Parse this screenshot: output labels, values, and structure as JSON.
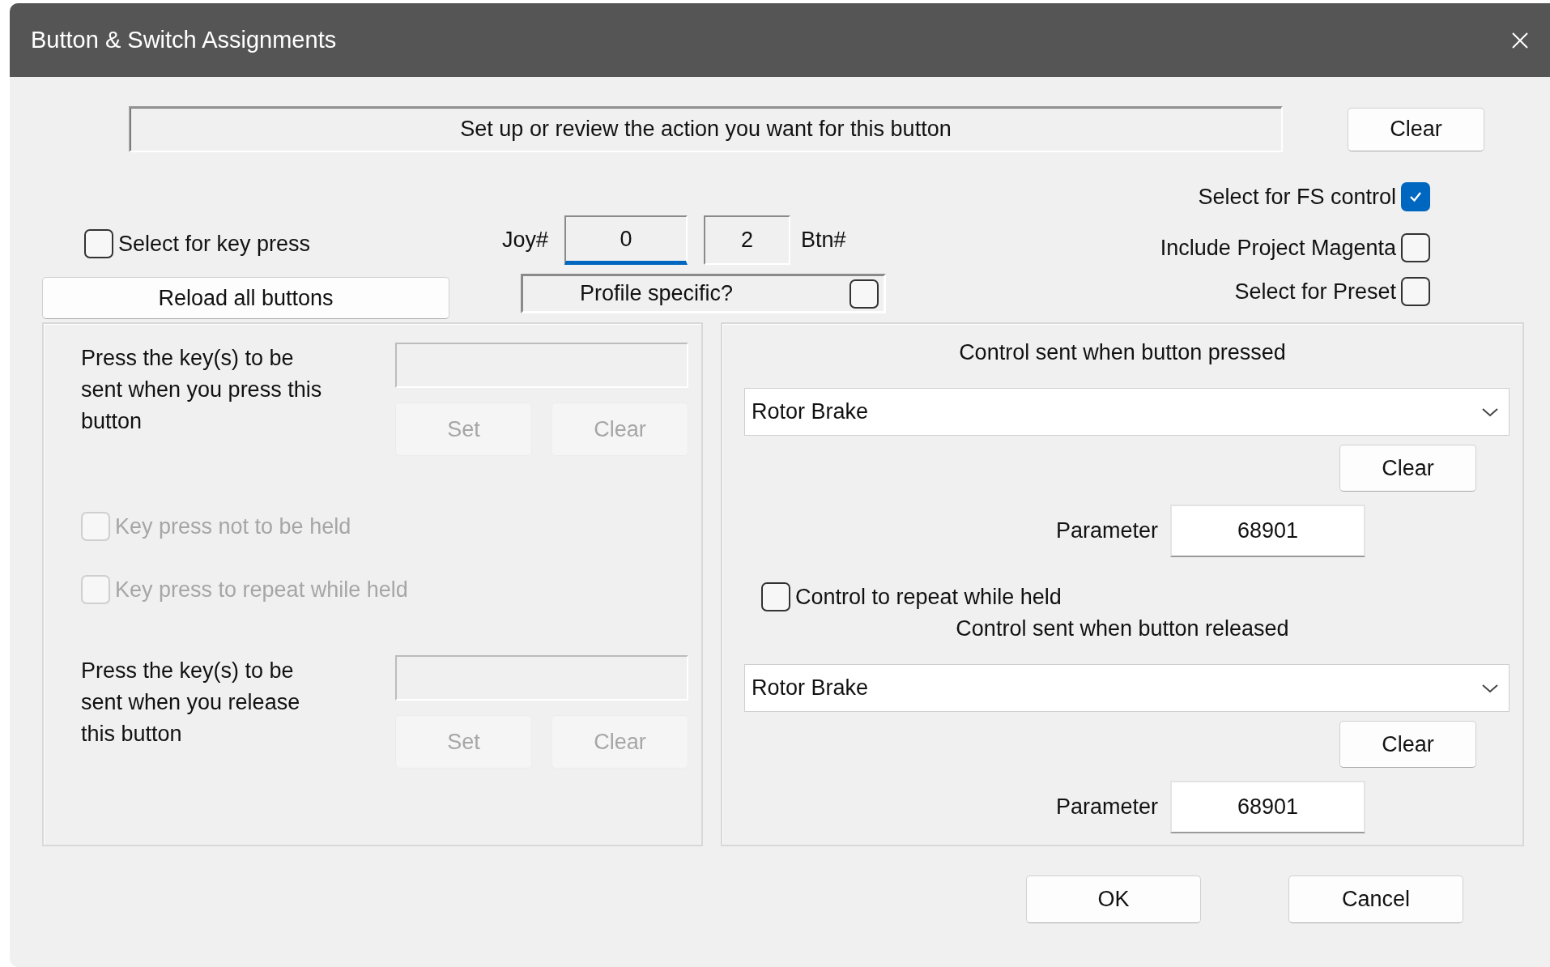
{
  "window": {
    "title": "Button & Switch Assignments"
  },
  "header": {
    "message": "Set up or review the action you want for this button",
    "clear_button": "Clear"
  },
  "key_press_option": {
    "label": "Select for key press",
    "checked": false
  },
  "reload_button": "Reload all buttons",
  "joystick": {
    "joy_label": "Joy#",
    "joy_value": "0",
    "joy_focused": true,
    "button_value": "2",
    "button_label": "Btn#"
  },
  "profile_specific": {
    "label": "Profile specific?",
    "checked": false
  },
  "options": [
    {
      "label": "Select for FS control",
      "checked": true
    },
    {
      "label": "Include Project Magenta",
      "checked": false
    },
    {
      "label": "Select for Preset",
      "checked": false
    }
  ],
  "key_panel": {
    "press": {
      "prompt": "Press the key(s) to be sent when you press this button",
      "set_button": "Set",
      "clear_button": "Clear",
      "disabled": true
    },
    "hold_options": [
      {
        "label": "Key press not to be held",
        "checked": false,
        "disabled": true
      },
      {
        "label": "Key press to repeat while held",
        "checked": false,
        "disabled": true
      }
    ],
    "release": {
      "prompt": "Press the key(s) to be sent when you release this button",
      "set_button": "Set",
      "clear_button": "Clear",
      "disabled": true
    }
  },
  "control_panel": {
    "pressed": {
      "heading": "Control sent when button pressed",
      "control": "Rotor Brake",
      "clear_button": "Clear",
      "parameter_label": "Parameter",
      "parameter": "68901"
    },
    "repeat_option": {
      "label": "Control to repeat while held",
      "checked": false
    },
    "released": {
      "heading": "Control sent when button released",
      "control": "Rotor Brake",
      "clear_button": "Clear",
      "parameter_label": "Parameter",
      "parameter": "68901"
    }
  },
  "buttons": [
    {
      "label": "OK"
    },
    {
      "label": "Cancel"
    }
  ]
}
